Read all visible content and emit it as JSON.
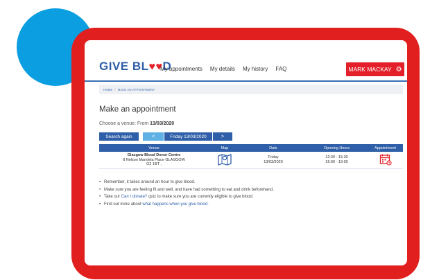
{
  "colors": {
    "frame": "#e11f1f",
    "circle": "#0b9ee0",
    "primary": "#2f5fa8",
    "accent_red": "#e3202a"
  },
  "header": {
    "logo_prefix": "GIVE BL",
    "logo_suffix": "D",
    "nav": [
      "My appointments",
      "My details",
      "My history",
      "FAQ"
    ],
    "user_label": "MARK MACKAY"
  },
  "breadcrumb": {
    "home": "HOME",
    "current": "MAKE AN APPOINTMENT"
  },
  "page": {
    "title": "Make an appointment",
    "venue_prefix": "Choose a venue: From",
    "venue_date": "13/03/2020"
  },
  "controls": {
    "search_label": "Search again",
    "prev_label": "<",
    "date_label": "Friday  13/03/2020",
    "next_label": ">"
  },
  "table": {
    "headers": [
      "Venue",
      "Map",
      "Date",
      "Opening Hours",
      "Appointment"
    ],
    "rows": [
      {
        "venue_name": "Glasgow Blood Donor Centre",
        "address_1": "8 Nelson Mandela Place GLASGOW",
        "address_2": "G2 1BT ,",
        "day": "Friday",
        "date": "13/03/2020",
        "hours_1": "12:30 - 15:30",
        "hours_2": "16:00 - 19:00"
      }
    ]
  },
  "notes": {
    "n1": "Remember, it takes around an hour to give blood.",
    "n2": "Make sure you are feeling fit and well, and have had something to eat and drink beforehand.",
    "n3_pre": "Take our",
    "n3_link": "Can I donate?",
    "n3_post": "quiz to make sure you are currently eligible to give blood.",
    "n4_pre": "Find out more about",
    "n4_link": "what happens when you give blood."
  }
}
